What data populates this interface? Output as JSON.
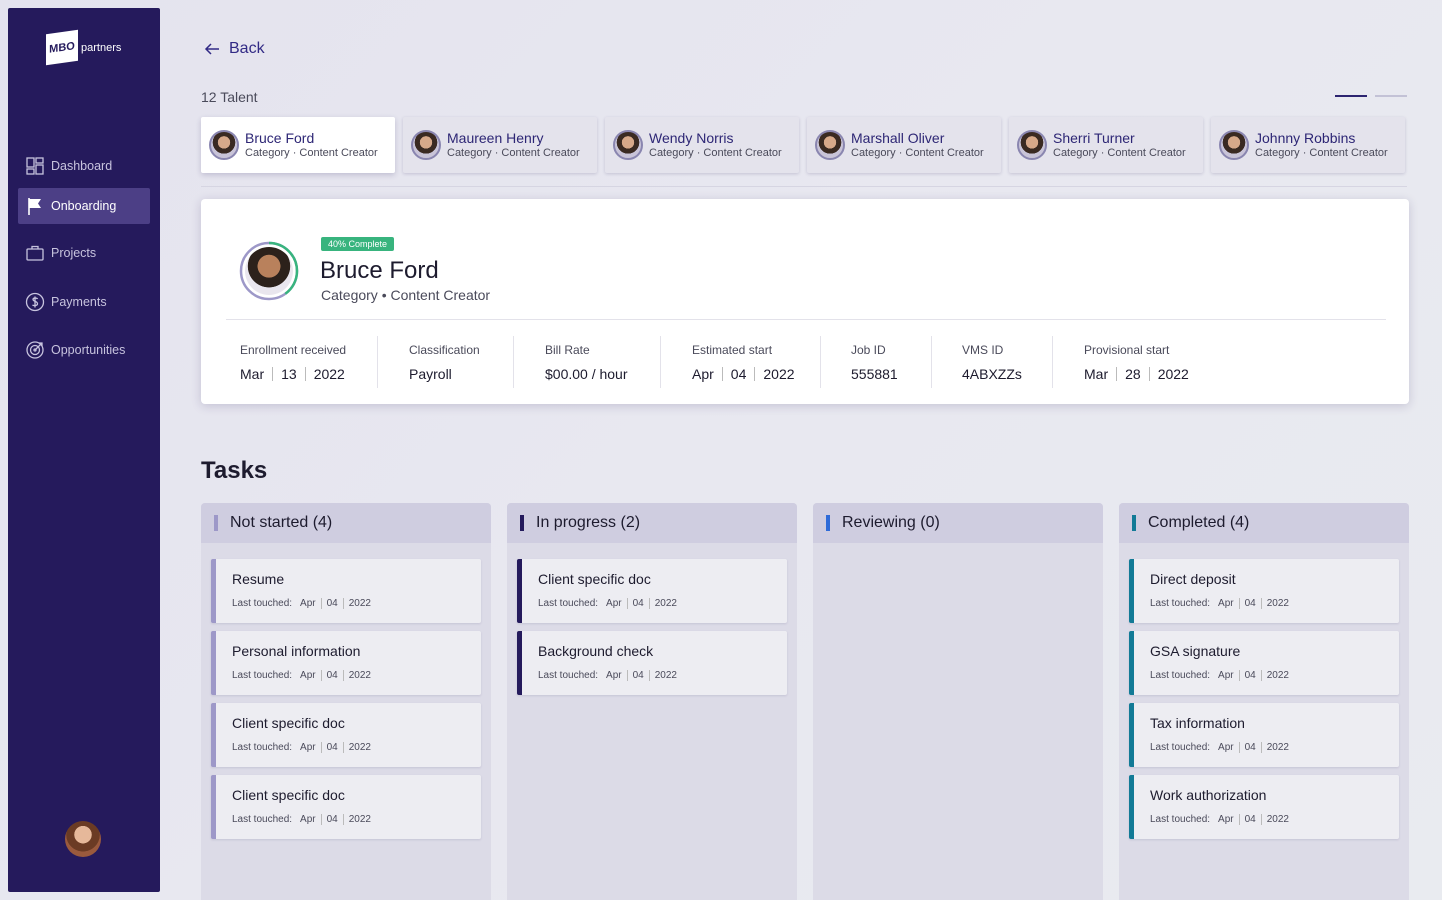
{
  "brand": {
    "logo_box": "MBO",
    "logo_text": "partners"
  },
  "sidebar": {
    "items": [
      {
        "label": "Dashboard",
        "icon": "dashboard-icon"
      },
      {
        "label": "Onboarding",
        "icon": "flag-icon",
        "active": true
      },
      {
        "label": "Projects",
        "icon": "briefcase-icon"
      },
      {
        "label": "Payments",
        "icon": "dollar-icon"
      },
      {
        "label": "Opportunities",
        "icon": "target-icon"
      }
    ]
  },
  "back_label": "Back",
  "talent_count": "12 Talent",
  "talents": [
    {
      "name": "Bruce Ford",
      "category": "Category · Content Creator"
    },
    {
      "name": "Maureen Henry",
      "category": "Category · Content Creator"
    },
    {
      "name": "Wendy Norris",
      "category": "Category · Content Creator"
    },
    {
      "name": "Marshall Oliver",
      "category": "Category · Content Creator"
    },
    {
      "name": "Sherri Turner",
      "category": "Category · Content Creator"
    },
    {
      "name": "Johnny Robbins",
      "category": "Category · Content Creator"
    }
  ],
  "profile": {
    "badge": "40% Complete",
    "progress_percent": 40,
    "name": "Bruce Ford",
    "category": "Category • Content Creator",
    "stats": [
      {
        "label": "Enrollment received",
        "parts": [
          "Mar",
          "13",
          "2022"
        ]
      },
      {
        "label": "Classification",
        "parts": [
          "Payroll"
        ]
      },
      {
        "label": "Bill Rate",
        "parts": [
          "$00.00 / hour"
        ]
      },
      {
        "label": "Estimated start",
        "parts": [
          "Apr",
          "04",
          "2022"
        ]
      },
      {
        "label": "Job ID",
        "parts": [
          "555881"
        ]
      },
      {
        "label": "VMS ID",
        "parts": [
          "4ABXZZs"
        ]
      },
      {
        "label": "Provisional start",
        "parts": [
          "Mar",
          "28",
          "2022"
        ]
      }
    ]
  },
  "tasks_title": "Tasks",
  "columns": [
    {
      "title": "Not started (4)",
      "accent": "#9d98c8",
      "items": [
        "Resume",
        "Personal information",
        "Client specific doc",
        "Client specific doc"
      ]
    },
    {
      "title": "In progress (2)",
      "accent": "#241a5c",
      "items": [
        "Client specific doc",
        "Background check"
      ]
    },
    {
      "title": "Reviewing (0)",
      "accent": "#2f6bd8",
      "items": []
    },
    {
      "title": "Completed (4)",
      "accent": "#127a96",
      "items": [
        "Direct deposit",
        "GSA signature",
        "Tax information",
        "Work authorization"
      ]
    }
  ],
  "last_touched": {
    "label": "Last touched:",
    "month": "Apr",
    "day": "04",
    "year": "2022"
  }
}
